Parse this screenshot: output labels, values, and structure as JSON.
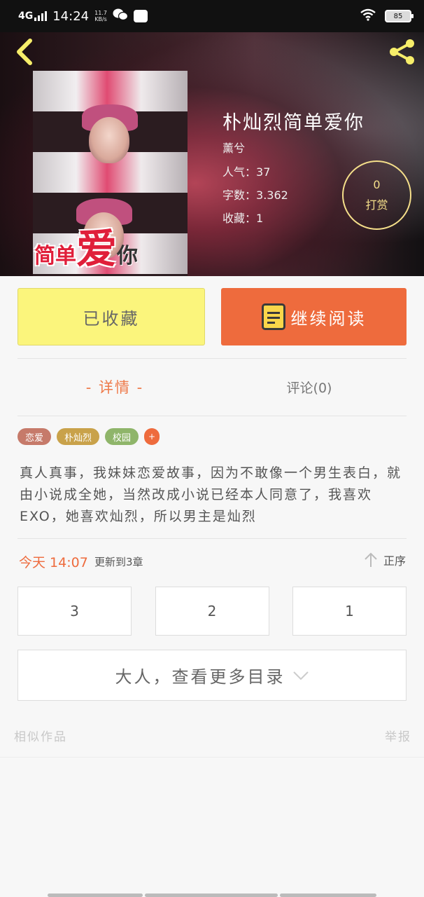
{
  "status_bar": {
    "network": "4G",
    "time": "14:24",
    "speed_value": "11.7",
    "speed_unit": "KB/s",
    "battery": "85"
  },
  "book": {
    "title": "朴灿烈简单爱你",
    "author": "薰兮",
    "popularity_label": "人气：",
    "popularity": "37",
    "words_label": "字数：",
    "words": "3.362",
    "favorites_label": "收藏：",
    "favorites": "1",
    "cover_text": [
      "简单",
      "爱",
      "你"
    ]
  },
  "reward": {
    "count": "0",
    "label": "打赏"
  },
  "actions": {
    "favorited_label": "已收藏",
    "continue_label": "继续阅读"
  },
  "tabs": {
    "detail": "- 详情 -",
    "comments": "评论(0)"
  },
  "tags": [
    {
      "label": "恋爱",
      "color": "#c67a6a"
    },
    {
      "label": "朴灿烈",
      "color": "#c9a24a"
    },
    {
      "label": "校园",
      "color": "#8fb56a"
    },
    {
      "label": "+",
      "color": "#ee6b3d"
    }
  ],
  "description": "真人真事，我妹妹恋爱故事，因为不敢像一个男生表白，就由小说成全她，当然改成小说已经本人同意了，我喜欢EXO，她喜欢灿烈，所以男主是灿烈",
  "update": {
    "time": "今天 14:07",
    "text": "更新到3章",
    "sort_label": "正序"
  },
  "chapters": [
    "3",
    "2",
    "1"
  ],
  "more_toc": "大人，查看更多目录",
  "footer": {
    "similar": "相似作品",
    "report": "举报"
  },
  "colors": {
    "accent": "#ee6b3d",
    "fav_button": "#fbf57c",
    "reward_ring": "#f5df8a"
  }
}
